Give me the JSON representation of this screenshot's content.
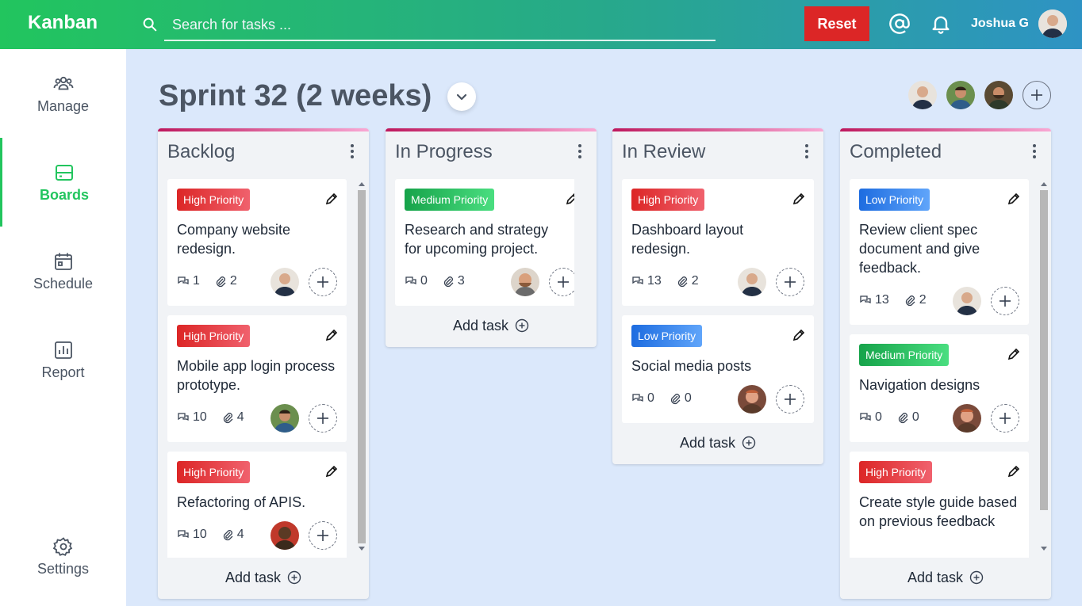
{
  "header": {
    "brand": "Kanban",
    "search_placeholder": "Search for tasks ...",
    "reset_label": "Reset",
    "user_name": "Joshua G"
  },
  "sidebar": {
    "items": [
      {
        "label": "Manage",
        "icon": "users-icon"
      },
      {
        "label": "Boards",
        "icon": "boards-icon",
        "active": true
      },
      {
        "label": "Schedule",
        "icon": "calendar-icon"
      },
      {
        "label": "Report",
        "icon": "report-icon"
      },
      {
        "label": "Settings",
        "icon": "gear-icon"
      }
    ]
  },
  "board": {
    "title": "Sprint 32 (2 weeks)"
  },
  "colors": {
    "high": "#dc2626",
    "medium": "#16a34a",
    "low": "#1d6ce0",
    "accent": "#22c55e"
  },
  "add_task_label": "Add task",
  "columns": [
    {
      "title": "Backlog",
      "cards": [
        {
          "priority": "High Priority",
          "title": "Company website redesign.",
          "comments": "1",
          "attachments": "2"
        },
        {
          "priority": "High Priority",
          "title": "Mobile app login process prototype.",
          "comments": "10",
          "attachments": "4"
        },
        {
          "priority": "High Priority",
          "title": "Refactoring of APIS.",
          "comments": "10",
          "attachments": "4"
        }
      ]
    },
    {
      "title": "In Progress",
      "cards": [
        {
          "priority": "Medium Priority",
          "title": "Research and strategy for upcoming project.",
          "comments": "0",
          "attachments": "3"
        }
      ]
    },
    {
      "title": "In Review",
      "cards": [
        {
          "priority": "High Priority",
          "title": "Dashboard layout redesign.",
          "comments": "13",
          "attachments": "2"
        },
        {
          "priority": "Low Priority",
          "title": "Social media posts",
          "comments": "0",
          "attachments": "0"
        }
      ]
    },
    {
      "title": "Completed",
      "cards": [
        {
          "priority": "Low Priority",
          "title": "Review client spec document and give feedback.",
          "comments": "13",
          "attachments": "2"
        },
        {
          "priority": "Medium Priority",
          "title": "Navigation designs",
          "comments": "0",
          "attachments": "0"
        },
        {
          "priority": "High Priority",
          "title": "Create style guide based on previous feedback"
        }
      ]
    }
  ]
}
